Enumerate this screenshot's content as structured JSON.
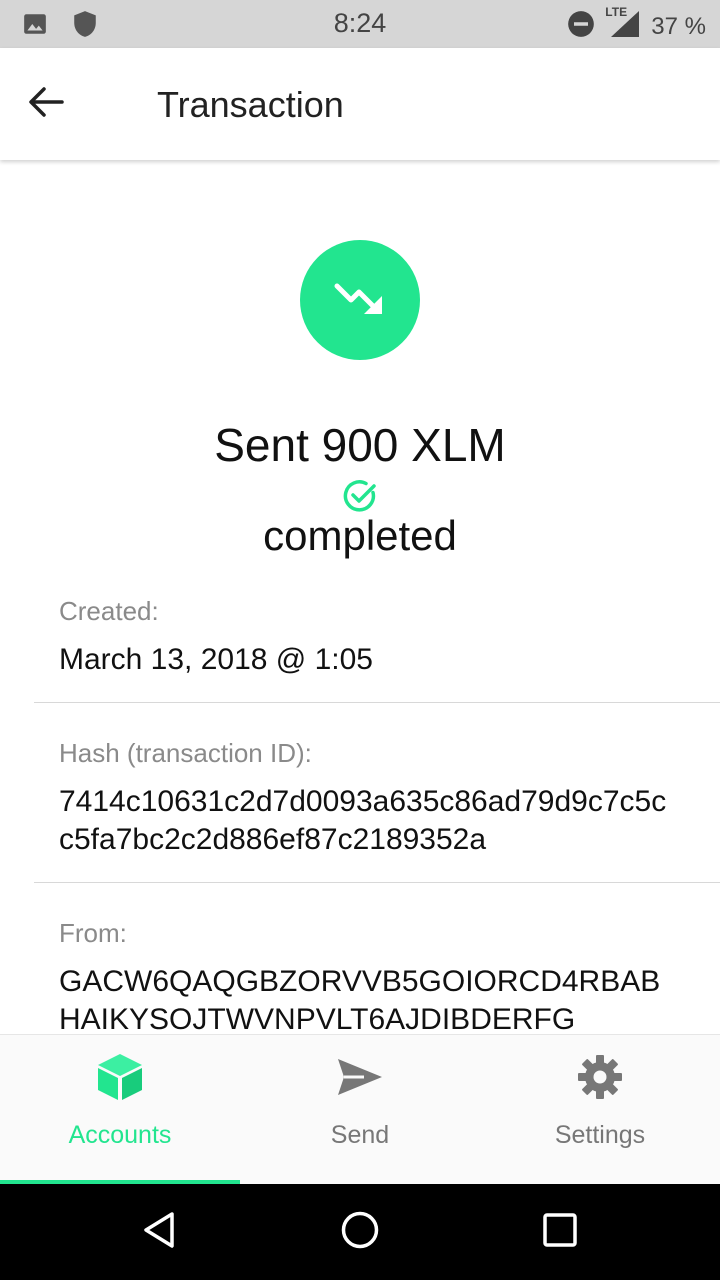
{
  "status_bar": {
    "time": "8:24",
    "battery": "37 %",
    "network": "LTE",
    "left_icons": [
      "image-icon",
      "shield-icon"
    ],
    "right_icons": [
      "do-not-disturb-icon",
      "signal-icon"
    ]
  },
  "header": {
    "title": "Transaction",
    "back_icon": "arrow-back-icon"
  },
  "transaction": {
    "icon": "trending-down-icon",
    "amount_text": "Sent 900 XLM",
    "status_icon": "check-circle-icon",
    "status": "completed",
    "fields": [
      {
        "label": "Created:",
        "value": "March 13, 2018 @ 1:05"
      },
      {
        "label": "Hash (transaction ID):",
        "value": "7414c10631c2d7d0093a635c86ad79d9c7c5cc5fa7bc2c2d886ef87c2189352a"
      },
      {
        "label": "From:",
        "value": "GACW6QAQGBZORVVB5GOIORCD4RBABHAIKYSOJTWVNPVLT6AJDIBDERFG"
      }
    ]
  },
  "bottom_nav": {
    "items": [
      {
        "label": "Accounts",
        "icon": "cube-icon",
        "active": true
      },
      {
        "label": "Send",
        "icon": "send-icon",
        "active": false
      },
      {
        "label": "Settings",
        "icon": "gear-icon",
        "active": false
      }
    ]
  },
  "system_nav": {
    "icons": [
      "back-triangle-icon",
      "home-circle-icon",
      "recents-square-icon"
    ]
  },
  "colors": {
    "accent": "#22e58f",
    "status_bar": "#d6d6d6",
    "label_gray": "#8a8a8a"
  }
}
